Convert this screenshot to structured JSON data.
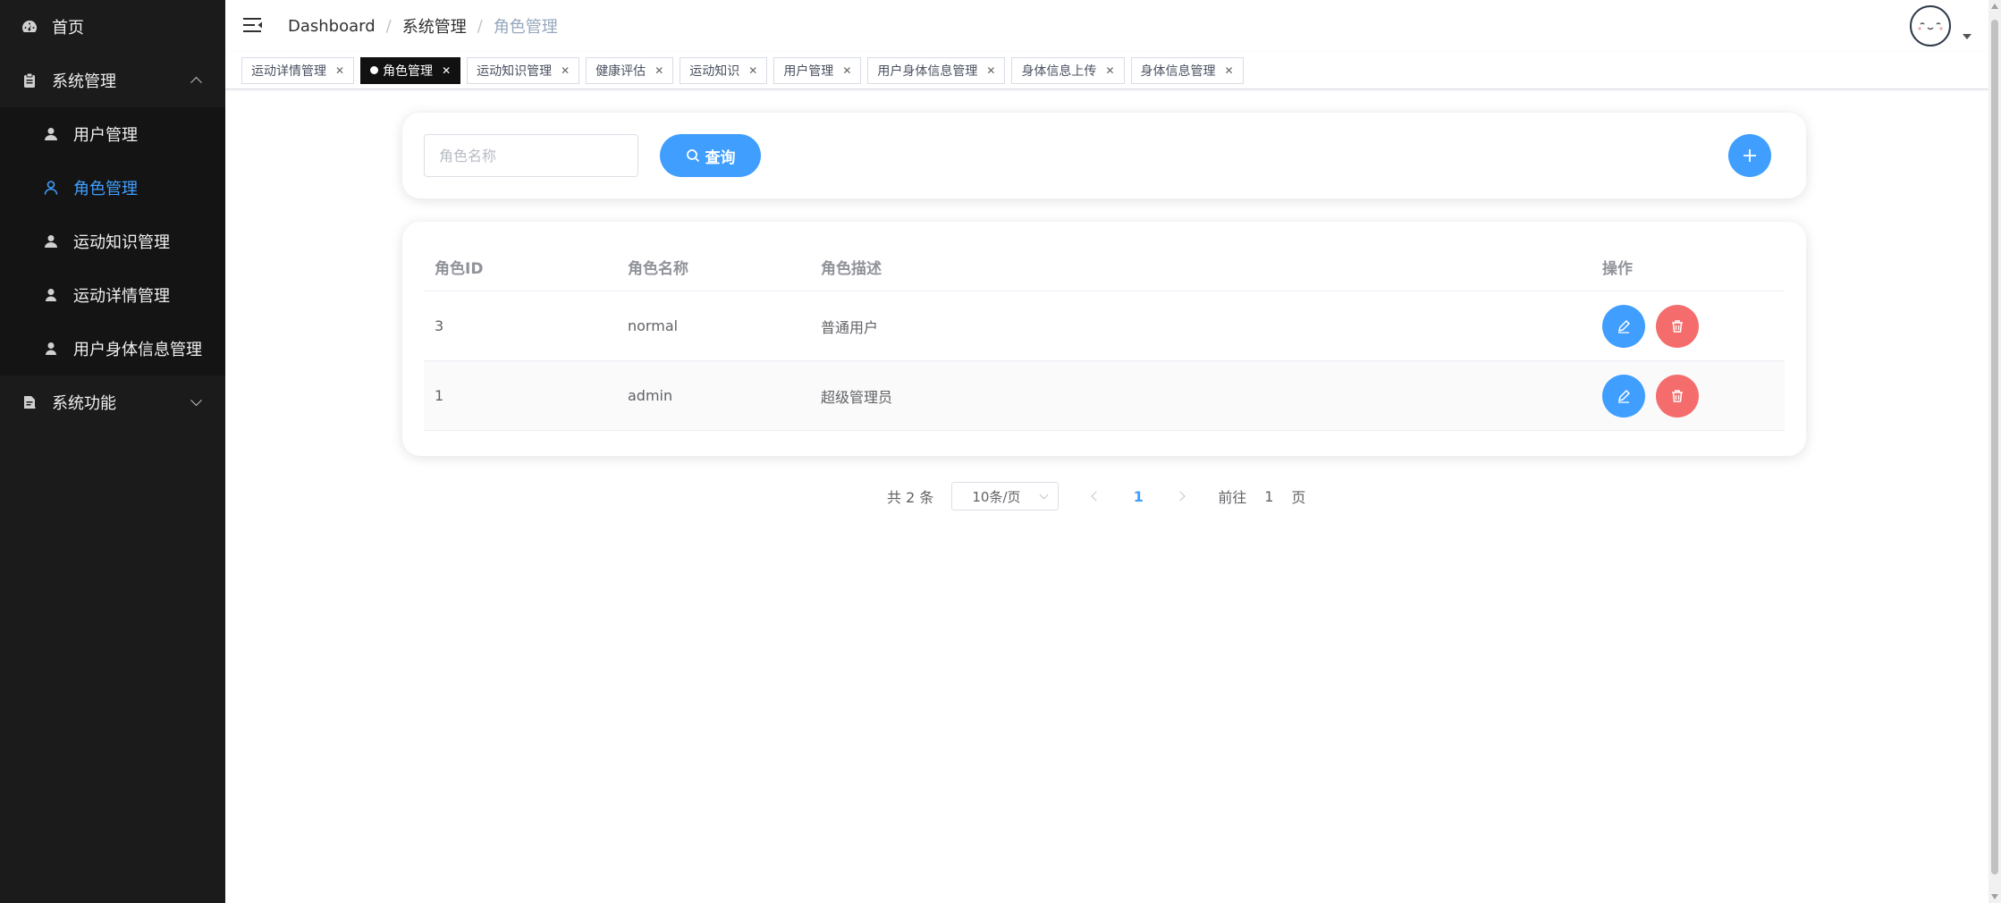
{
  "sidebar": {
    "home": {
      "label": "首页",
      "icon": "dashboard-icon"
    },
    "system_mgmt": {
      "label": "系统管理",
      "icon": "clipboard-icon",
      "expanded": true,
      "items": [
        {
          "label": "用户管理",
          "icon": "user-icon",
          "active": false
        },
        {
          "label": "角色管理",
          "icon": "user-outline-icon",
          "active": true
        },
        {
          "label": "运动知识管理",
          "icon": "user-icon",
          "active": false
        },
        {
          "label": "运动详情管理",
          "icon": "user-icon",
          "active": false
        },
        {
          "label": "用户身体信息管理",
          "icon": "user-icon",
          "active": false
        }
      ]
    },
    "system_func": {
      "label": "系统功能",
      "icon": "document-icon",
      "expanded": false
    }
  },
  "header": {
    "breadcrumb": [
      "Dashboard",
      "系统管理",
      "角色管理"
    ]
  },
  "tags": [
    {
      "label": "运动详情管理",
      "active": false
    },
    {
      "label": "角色管理",
      "active": true
    },
    {
      "label": "运动知识管理",
      "active": false
    },
    {
      "label": "健康评估",
      "active": false
    },
    {
      "label": "运动知识",
      "active": false
    },
    {
      "label": "用户管理",
      "active": false
    },
    {
      "label": "用户身体信息管理",
      "active": false
    },
    {
      "label": "身体信息上传",
      "active": false
    },
    {
      "label": "身体信息管理",
      "active": false
    }
  ],
  "search": {
    "placeholder": "角色名称",
    "value": "",
    "query_label": "查询"
  },
  "table": {
    "columns": [
      "角色ID",
      "角色名称",
      "角色描述",
      "操作"
    ],
    "rows": [
      {
        "id": "3",
        "name": "normal",
        "desc": "普通用户"
      },
      {
        "id": "1",
        "name": "admin",
        "desc": "超级管理员"
      }
    ]
  },
  "pagination": {
    "total_text": "共 2 条",
    "page_size": "10条/页",
    "current_page": "1",
    "goto_prefix": "前往",
    "goto_value": "1",
    "goto_suffix": "页"
  },
  "colors": {
    "primary": "#409eff",
    "danger": "#f56c6c",
    "sidebar_bg": "#1b1b1b"
  }
}
